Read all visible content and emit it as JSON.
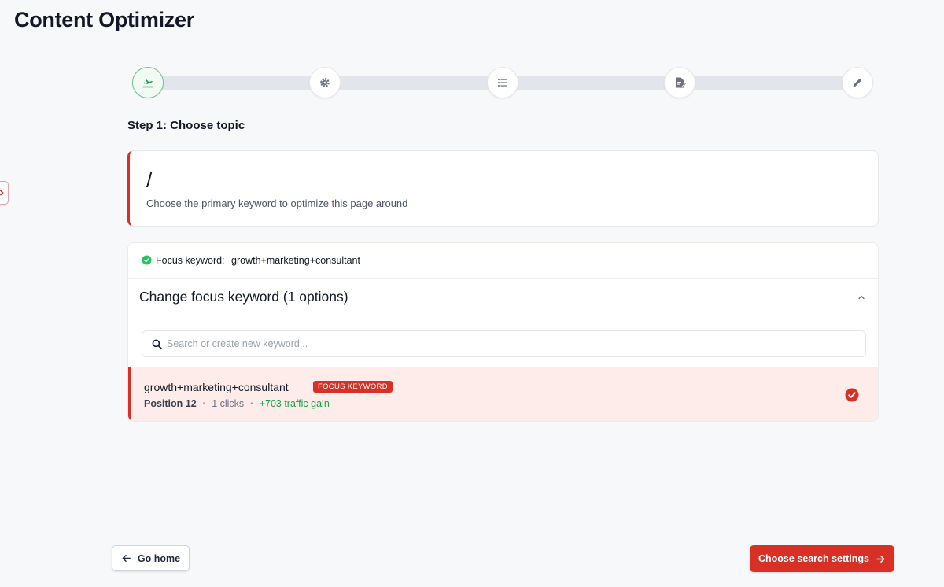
{
  "header": {
    "title": "Content Optimizer"
  },
  "stepper": {
    "steps": [
      {
        "icon": "plane-takeoff-icon",
        "active": true
      },
      {
        "icon": "gear-icon",
        "active": false
      },
      {
        "icon": "list-icon",
        "active": false
      },
      {
        "icon": "document-edit-icon",
        "active": false
      },
      {
        "icon": "pencil-icon",
        "active": false
      }
    ]
  },
  "step": {
    "heading": "Step 1: Choose topic"
  },
  "topic": {
    "path": "/",
    "description": "Choose the primary keyword to optimize this page around"
  },
  "focus": {
    "label": "Focus keyword:",
    "value": "growth+marketing+consultant"
  },
  "change": {
    "title": "Change focus keyword (1 options)"
  },
  "search": {
    "placeholder": "Search or create new keyword..."
  },
  "options": [
    {
      "keyword": "growth+marketing+consultant",
      "badge": "FOCUS KEYWORD",
      "position": "Position 12",
      "clicks": "1 clicks",
      "gain": "+703 traffic gain"
    }
  ],
  "buttons": {
    "home": "Go home",
    "next": "Choose search settings"
  },
  "colors": {
    "accent": "#d93025",
    "success": "#16a34a",
    "highlight": "#fdecea"
  }
}
